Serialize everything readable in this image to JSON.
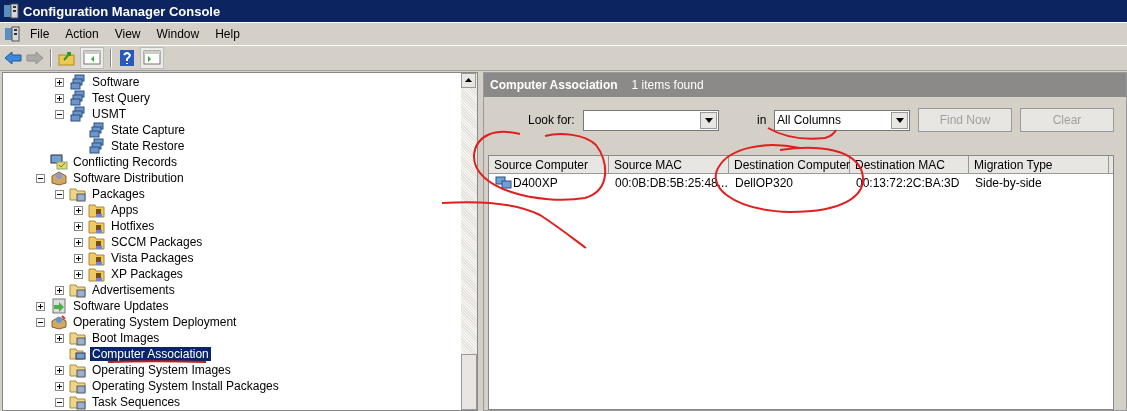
{
  "window": {
    "title": "Configuration Manager Console"
  },
  "menu": [
    {
      "label": "File"
    },
    {
      "label": "Action"
    },
    {
      "label": "View"
    },
    {
      "label": "Window"
    },
    {
      "label": "Help"
    }
  ],
  "toolbar": [
    {
      "kind": "back",
      "disabled": false
    },
    {
      "kind": "forward",
      "disabled": true
    },
    {
      "kind": "separator"
    },
    {
      "kind": "up"
    },
    {
      "kind": "tree"
    },
    {
      "kind": "separator"
    },
    {
      "kind": "help"
    },
    {
      "kind": "pane"
    }
  ],
  "tree": {
    "partial_branch": [
      {
        "label": "Software",
        "kind": "query",
        "expanded": false,
        "selected": false
      },
      {
        "label": "Test Query",
        "kind": "query",
        "expanded": false,
        "selected": false
      },
      {
        "label": "USMT",
        "kind": "query",
        "expanded": true,
        "selected": false,
        "children": [
          {
            "label": "State Capture",
            "kind": "query",
            "selected": false
          },
          {
            "label": "State Restore",
            "kind": "query",
            "selected": false
          }
        ]
      }
    ],
    "items": [
      {
        "label": "Conflicting Records",
        "kind": "records",
        "selected": false
      },
      {
        "label": "Software Distribution",
        "kind": "distribution",
        "expanded": true,
        "selected": false,
        "children": [
          {
            "label": "Packages",
            "kind": "packages",
            "expanded": true,
            "selected": false,
            "children": [
              {
                "label": "Apps",
                "kind": "package",
                "expanded": false,
                "selected": false
              },
              {
                "label": "Hotfixes",
                "kind": "package",
                "expanded": false,
                "selected": false
              },
              {
                "label": "SCCM Packages",
                "kind": "package",
                "expanded": false,
                "selected": false
              },
              {
                "label": "Vista Packages",
                "kind": "package",
                "expanded": false,
                "selected": false
              },
              {
                "label": "XP Packages",
                "kind": "package",
                "expanded": false,
                "selected": false
              }
            ]
          },
          {
            "label": "Advertisements",
            "kind": "folder",
            "expanded": false,
            "selected": false
          }
        ]
      },
      {
        "label": "Software Updates",
        "kind": "updates",
        "expanded": false,
        "selected": false
      },
      {
        "label": "Operating System Deployment",
        "kind": "osd",
        "expanded": true,
        "selected": false,
        "children": [
          {
            "label": "Boot Images",
            "kind": "folder",
            "expanded": false,
            "selected": false
          },
          {
            "label": "Computer Association",
            "kind": "computers",
            "selected": true
          },
          {
            "label": "Operating System Images",
            "kind": "folder",
            "expanded": false,
            "selected": false
          },
          {
            "label": "Operating System Install Packages",
            "kind": "folder",
            "expanded": false,
            "selected": false
          },
          {
            "label": "Task Sequences",
            "kind": "folder",
            "expanded": true,
            "selected": false
          }
        ]
      }
    ]
  },
  "results": {
    "title": "Computer Association",
    "count": "1 items found",
    "look_for": {
      "label": "Look for:"
    },
    "in": {
      "label": "in",
      "value": "All Columns"
    },
    "buttons": [
      {
        "label": "Find Now",
        "disabled": true
      },
      {
        "label": "Clear",
        "disabled": true
      }
    ],
    "table": {
      "columns": [
        "Source Computer",
        "Source MAC",
        "Destination Computer",
        "Destination MAC",
        "Migration Type"
      ],
      "rows": [
        [
          "D400XP",
          "00:0B:DB:5B:25:48...",
          "DellOP320",
          "00:13:72:2C:BA:3D",
          "Side-by-side"
        ]
      ]
    }
  }
}
